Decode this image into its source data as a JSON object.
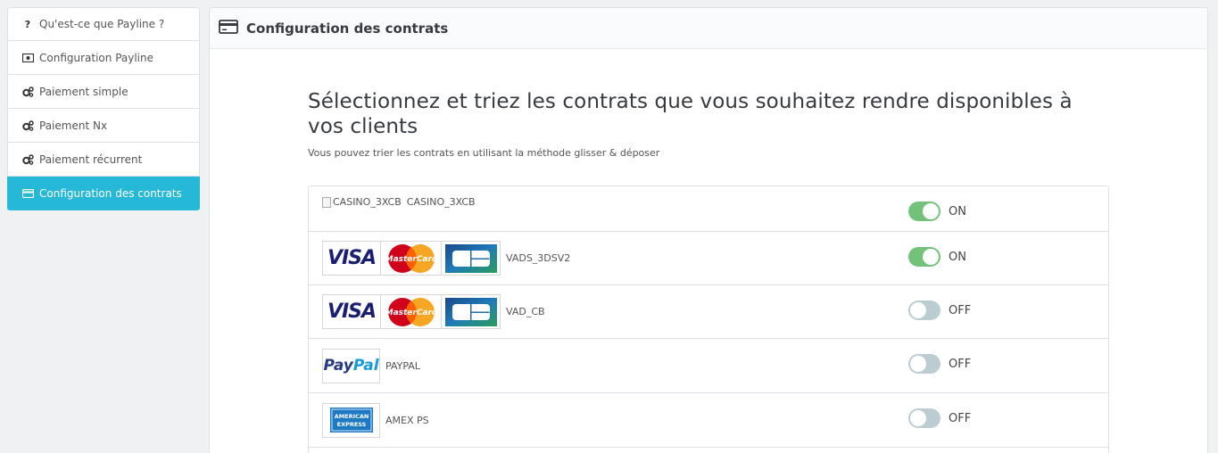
{
  "sidebar": {
    "items": [
      {
        "label": "Qu'est-ce que Payline ?",
        "icon": "question-icon"
      },
      {
        "label": "Configuration Payline",
        "icon": "money-icon"
      },
      {
        "label": "Paiement simple",
        "icon": "gears-icon"
      },
      {
        "label": "Paiement Nx",
        "icon": "gears-icon"
      },
      {
        "label": "Paiement récurrent",
        "icon": "gears-icon"
      },
      {
        "label": "Configuration des contrats",
        "icon": "credit-card-icon",
        "active": true
      }
    ]
  },
  "panel": {
    "title": "Configuration des contrats",
    "heading": "Sélectionnez et triez les contrats que vous souhaitez rendre disponibles à vos clients",
    "subtitle": "Vous pouvez trier les contrats en utilisant la méthode glisser & déposer"
  },
  "logos": {
    "visa": "VISA",
    "mastercard": "MasterCard",
    "paypal_pay": "Pay",
    "paypal_pal": "Pal",
    "amex_line1": "AMERICAN",
    "amex_line2": "EXPRESS"
  },
  "contracts": [
    {
      "name": "CASINO_3XCB",
      "image_alt": "CASINO_3XCB",
      "state": "ON",
      "enabled": true
    },
    {
      "name": "VADS_3DSV2",
      "state": "ON",
      "enabled": true
    },
    {
      "name": "VAD_CB",
      "state": "OFF",
      "enabled": false
    },
    {
      "name": "PAYPAL",
      "state": "OFF",
      "enabled": false
    },
    {
      "name": "AMEX PS",
      "state": "OFF",
      "enabled": false
    }
  ],
  "colors": {
    "accent": "#25b9d7",
    "toggle_on": "#72c279",
    "toggle_off": "#bbcdd2"
  }
}
